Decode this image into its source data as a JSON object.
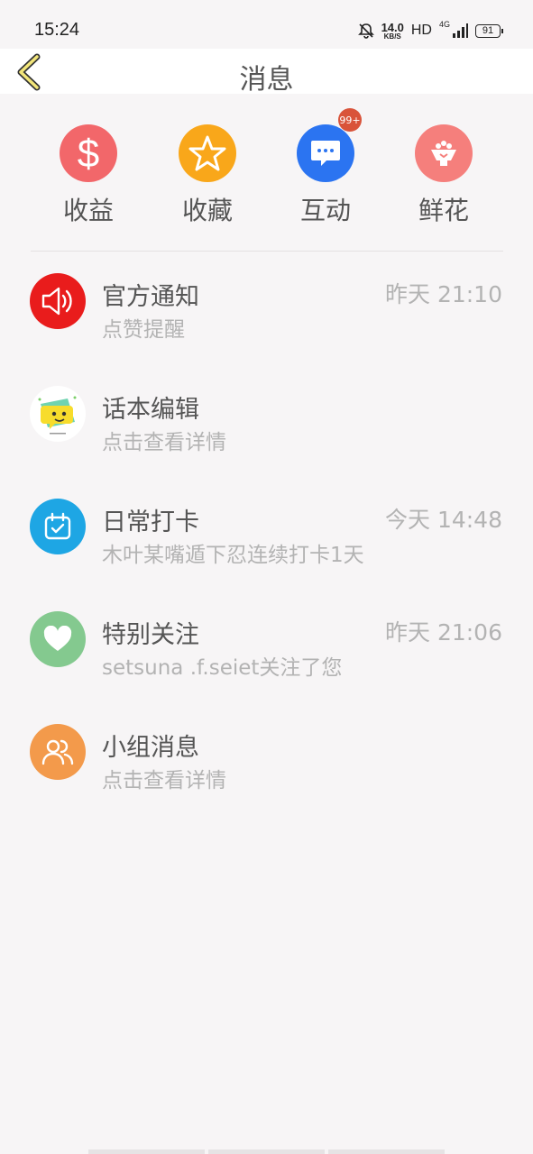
{
  "status_bar": {
    "time": "15:24",
    "speed_value": "14.0",
    "speed_unit": "KB/S",
    "hd": "HD",
    "network": "4G",
    "battery": "91"
  },
  "header": {
    "title": "消息"
  },
  "quick_actions": [
    {
      "label": "收益",
      "icon": "dollar-icon",
      "color": "#f2676a"
    },
    {
      "label": "收藏",
      "icon": "star-icon",
      "color": "#f9a71a"
    },
    {
      "label": "互动",
      "icon": "chat-bubble-icon",
      "color": "#2b74f1",
      "badge": "99+"
    },
    {
      "label": "鲜花",
      "icon": "flower-bowl-icon",
      "color": "#f57f7c"
    }
  ],
  "messages": [
    {
      "title": "官方通知",
      "subtitle": "点赞提醒",
      "time": "昨天 21:10",
      "icon": "speaker-icon",
      "color": "#e91c1c"
    },
    {
      "title": "话本编辑",
      "subtitle": "点击查看详情",
      "time": "",
      "icon": "editor-avatar-icon",
      "color": "#ffffff"
    },
    {
      "title": "日常打卡",
      "subtitle": "木叶某嘴遁下忍连续打卡1天",
      "time": "今天 14:48",
      "icon": "calendar-check-icon",
      "color": "#1ea6e4"
    },
    {
      "title": "特别关注",
      "subtitle": "setsuna .f.seiet关注了您",
      "time": "昨天 21:06",
      "icon": "heart-icon",
      "color": "#84c98f"
    },
    {
      "title": "小组消息",
      "subtitle": "点击查看详情",
      "time": "",
      "icon": "group-users-icon",
      "color": "#f39a4b"
    }
  ]
}
